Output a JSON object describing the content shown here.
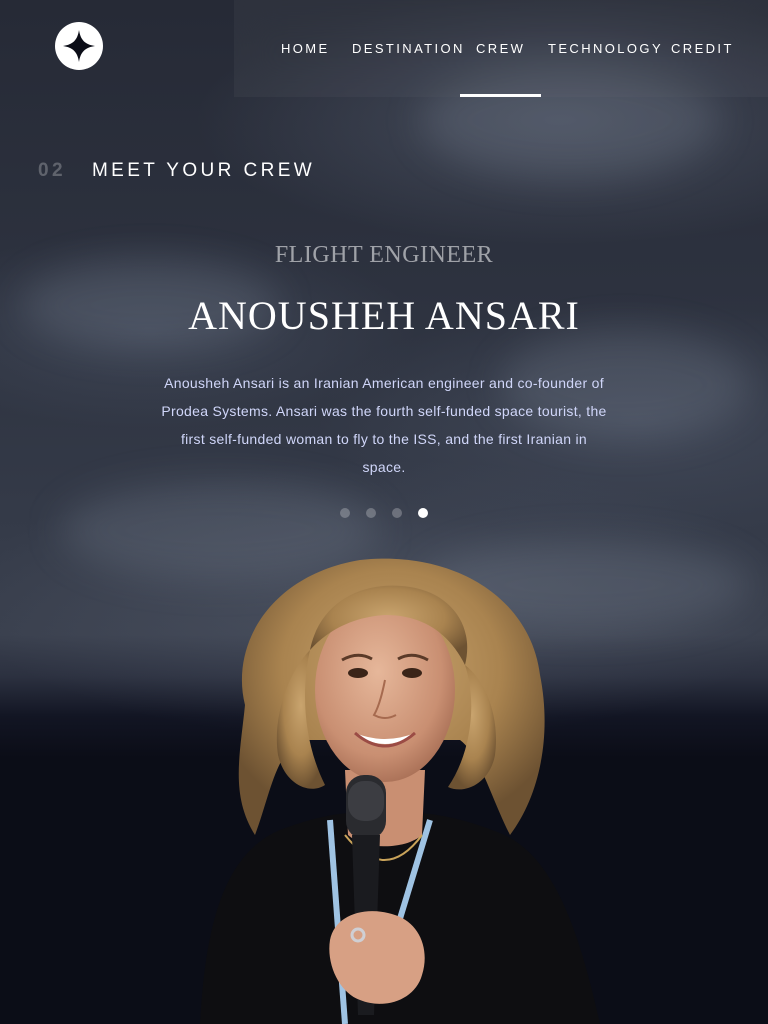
{
  "nav": {
    "items": [
      {
        "label": "HOME"
      },
      {
        "label": "DESTINATION"
      },
      {
        "label": "CREW"
      },
      {
        "label": "TECHNOLOGY"
      },
      {
        "label": "CREDIT"
      }
    ],
    "active": "CREW"
  },
  "heading": {
    "number": "02",
    "title": "MEET YOUR CREW"
  },
  "crew": {
    "role": "FLIGHT ENGINEER",
    "name": "ANOUSHEH ANSARI",
    "bio": "Anousheh Ansari is an Iranian American engineer and co-founder of Prodea Systems. Ansari was the fourth self-funded space tourist, the first self-funded woman to fly to the ISS, and the first Iranian in space.",
    "slide_count": 4,
    "active_slide": 4
  },
  "colors": {
    "background": "#0b0d17",
    "text": "#ffffff",
    "body_text": "#d0d6f9"
  }
}
